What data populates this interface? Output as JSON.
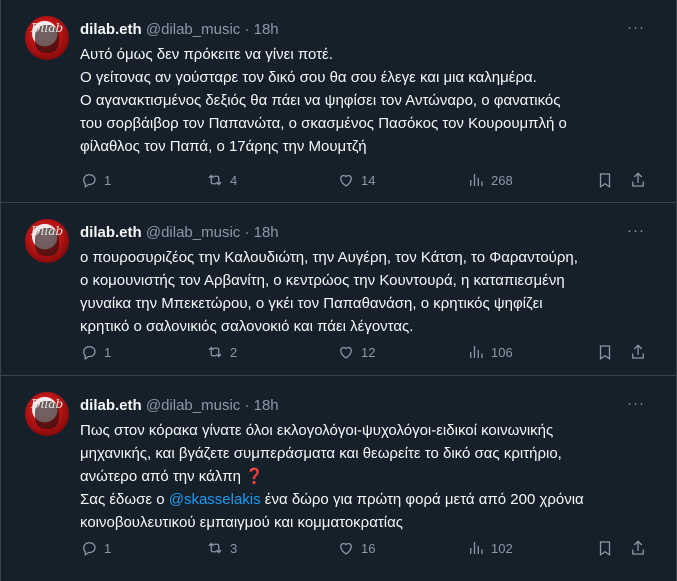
{
  "colors": {
    "background": "#15202b",
    "text": "#f7f9f9",
    "muted": "#8b98a5",
    "link": "#1d9bf0",
    "border": "#38444d"
  },
  "tweets": [
    {
      "name": "dilab.eth",
      "handle": "@dilab_music",
      "dot": "·",
      "time": "18h",
      "lines": [
        "Αυτό όμως δεν πρόκειτε να γίνει ποτέ.",
        "Ο γείτονας αν γούσταρε τον δικό σου θα σου έλεγε και μια καλημέρα.",
        "Ο αγανακτισμένος δεξιός θα πάει να ψηφίσει τον Αντώναρο, ο φανατικός",
        "του σορβάιβορ τον Παπανώτα, ο σκασμένος Πασόκος τον Κουρουμπλή ο",
        "φίλαθλος τον Παπά, ο 17άρης την Μουμτζή"
      ],
      "replies": "1",
      "retweets": "4",
      "likes": "14",
      "views": "268"
    },
    {
      "name": "dilab.eth",
      "handle": "@dilab_music",
      "dot": "·",
      "time": "18h",
      "lines": [
        "ο πουροσυριζέος την Καλουδιώτη, την Αυγέρη, τον Κάτση, το Φαραντούρη,",
        "ο κομουνιστής τον Αρβανίτη, ο κεντρώος την Κουντουρά, η καταπιεσμένη",
        "γυναίκα την Μπεκετώρου, ο γκέι τον Παπαθανάση, ο κρητικός ψηφίζει",
        "κρητικό ο σαλονικιός σαλονοκιό και πάει λέγοντας."
      ],
      "replies": "1",
      "retweets": "2",
      "likes": "12",
      "views": "106"
    },
    {
      "name": "dilab.eth",
      "handle": "@dilab_music",
      "dot": "·",
      "time": "18h",
      "lines": [
        "Πως στον κόρακα γίνατε όλοι εκλογολόγοι-ψυχολόγοι-ειδικοί κοινωνικής",
        "μηχανικής, και  βγάζετε συμπεράσματα και θεωρείτε το δικό σας κριτήριο,",
        "ανώτερο από την κάλπη ❓"
      ],
      "line4_prefix": "Σας έδωσε ο ",
      "mention": "@skasselakis",
      "line4_suffix": " ένα δώρο για πρώτη φορά μετά από 200 χρόνια",
      "line5": "κοινοβουλευτικού εμπαιγμού και κομματοκρατίας",
      "replies": "1",
      "retweets": "3",
      "likes": "16",
      "views": "102"
    }
  ],
  "more_label": "···"
}
